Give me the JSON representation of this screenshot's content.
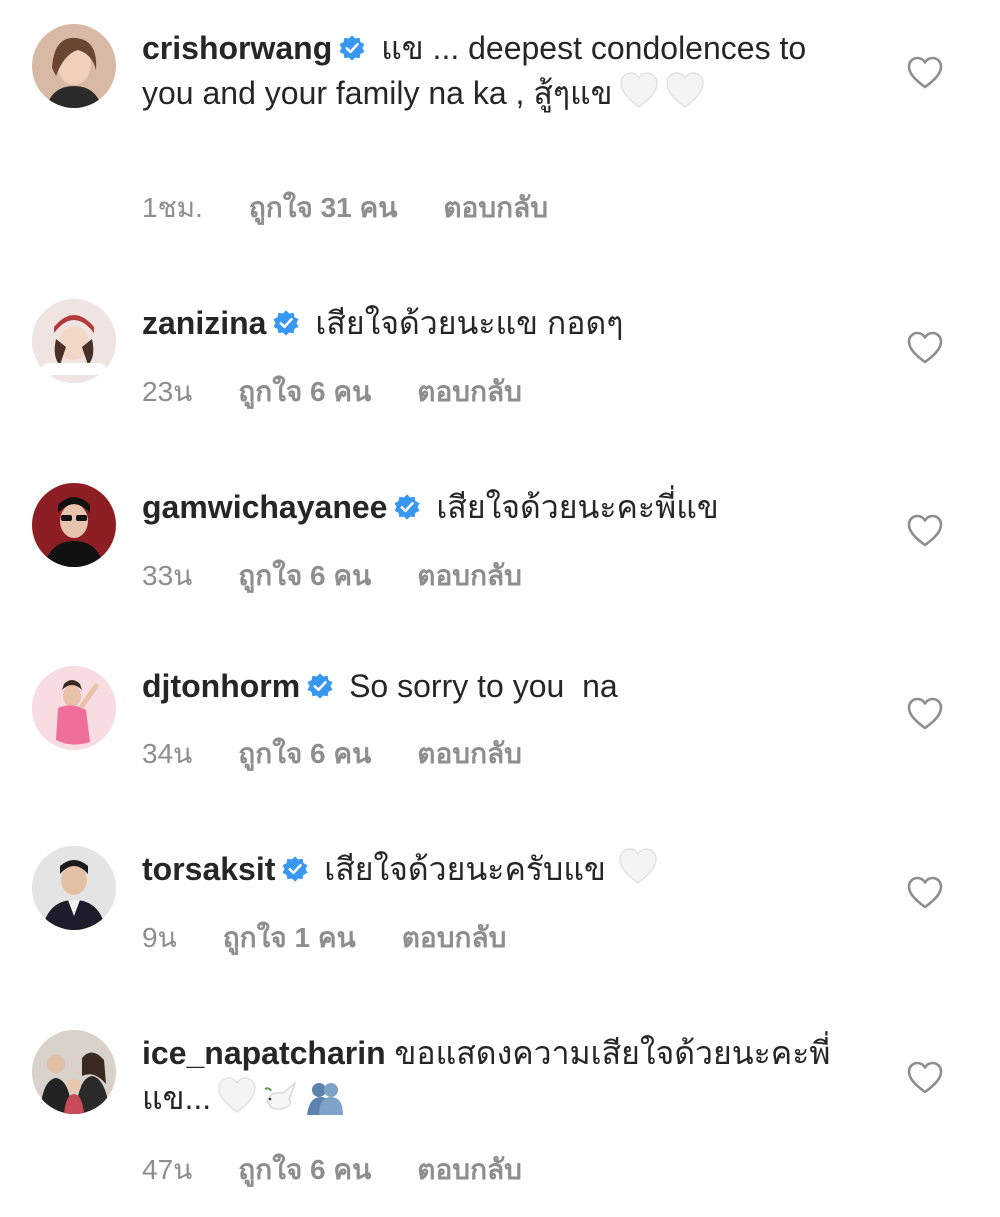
{
  "comments": [
    {
      "username": "crishorwang",
      "text": " แข ... deepest condolences to you and your family na ka , สู้ๆแข",
      "emojis": [
        "white-heart",
        "white-heart"
      ],
      "time": "1ชม.",
      "likes": "ถูกใจ 31 คน",
      "reply": "ตอบกลับ",
      "avatar_color": "#c8a58f"
    },
    {
      "username": "zanizina",
      "text": " เสียใจด้วยนะแข กอดๆ",
      "emojis": [],
      "time": "23น",
      "likes": "ถูกใจ 6 คน",
      "reply": "ตอบกลับ",
      "avatar_color": "#e9d6d2"
    },
    {
      "username": "gamwichayanee",
      "text": " เสียใจด้วยนะคะพี่แข",
      "emojis": [],
      "time": "33น",
      "likes": "ถูกใจ 6 คน",
      "reply": "ตอบกลับ",
      "avatar_color": "#8d1f24"
    },
    {
      "username": "djtonhorm",
      "text": " So sorry to you  na",
      "emojis": [],
      "time": "34น",
      "likes": "ถูกใจ 6 คน",
      "reply": "ตอบกลับ",
      "avatar_color": "#f3c9d0"
    },
    {
      "username": "torsaksit",
      "text": " เสียใจด้วยนะครับแข",
      "emojis": [
        "white-heart"
      ],
      "time": "9น",
      "likes": "ถูกใจ 1 คน",
      "reply": "ตอบกลับ",
      "avatar_color": "#d9d9d9"
    },
    {
      "username": "ice_napatcharin",
      "text": " ขอแสดงความเสียใจด้วยนะคะพี่แข...",
      "emojis": [
        "white-heart",
        "dove",
        "people-hugging"
      ],
      "time": "47น",
      "likes": "ถูกใจ 6 คน",
      "reply": "ตอบกลับ",
      "avatar_color": "#9a8b7e"
    }
  ],
  "icons": {
    "verified": "verified-badge-icon",
    "like": "heart-outline-icon"
  },
  "colors": {
    "verified_blue": "#3897f0",
    "text": "#262626",
    "meta_gray": "#8e8e8e"
  }
}
